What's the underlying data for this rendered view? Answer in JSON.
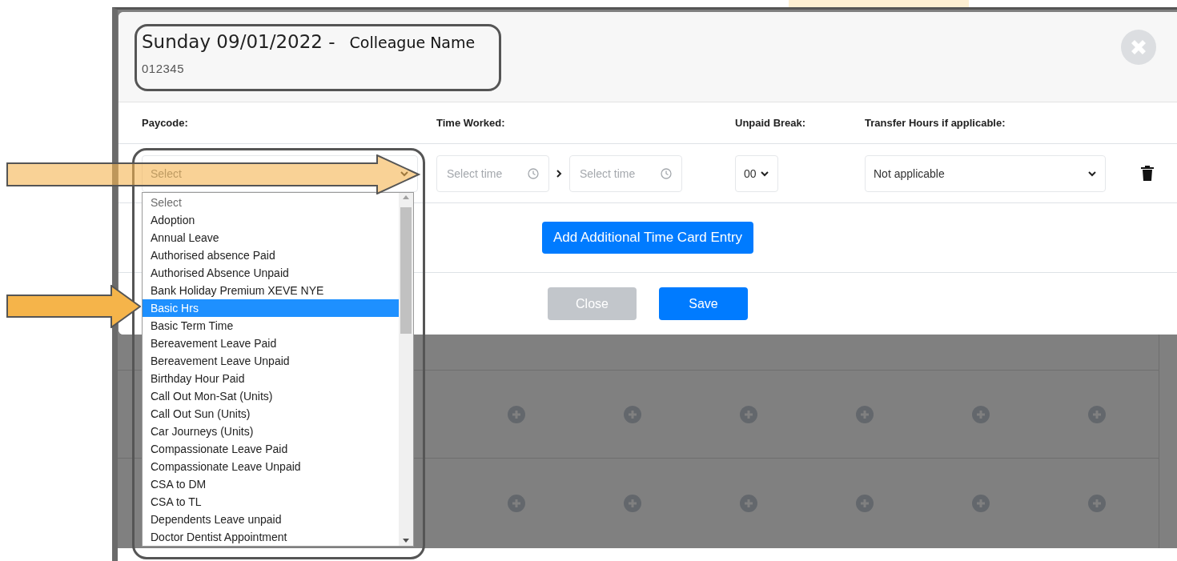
{
  "dialog": {
    "title": "Sunday 09/01/2022 -",
    "colleague_name": "Colleague Name",
    "colleague_id": "012345"
  },
  "columns": [
    "Paycode:",
    "Time Worked:",
    "Unpaid Break:",
    "Transfer Hours if applicable:"
  ],
  "entry": {
    "paycode": "Select",
    "time_from": {
      "placeholder": "Select time"
    },
    "time_to": {
      "placeholder": "Select time"
    },
    "unpaid_break": "00",
    "transfer": "Not applicable"
  },
  "paycode_options": [
    {
      "label": "Select",
      "selected": false,
      "disabled": true
    },
    {
      "label": "Adoption",
      "selected": false,
      "disabled": false
    },
    {
      "label": "Annual Leave",
      "selected": false,
      "disabled": false
    },
    {
      "label": "Authorised absence Paid",
      "selected": false,
      "disabled": false
    },
    {
      "label": "Authorised Absence Unpaid",
      "selected": false,
      "disabled": false
    },
    {
      "label": "Bank Holiday Premium XEVE NYE",
      "selected": false,
      "disabled": false
    },
    {
      "label": "Basic Hrs",
      "selected": true,
      "disabled": false
    },
    {
      "label": "Basic Term Time",
      "selected": false,
      "disabled": false
    },
    {
      "label": "Bereavement Leave Paid",
      "selected": false,
      "disabled": false
    },
    {
      "label": "Bereavement Leave Unpaid",
      "selected": false,
      "disabled": false
    },
    {
      "label": "Birthday Hour Paid",
      "selected": false,
      "disabled": false
    },
    {
      "label": "Call Out Mon-Sat (Units)",
      "selected": false,
      "disabled": false
    },
    {
      "label": "Call Out Sun (Units)",
      "selected": false,
      "disabled": false
    },
    {
      "label": "Car Journeys (Units)",
      "selected": false,
      "disabled": false
    },
    {
      "label": "Compassionate Leave Paid",
      "selected": false,
      "disabled": false
    },
    {
      "label": "Compassionate Leave Unpaid",
      "selected": false,
      "disabled": false
    },
    {
      "label": "CSA to DM",
      "selected": false,
      "disabled": false
    },
    {
      "label": "CSA to TL",
      "selected": false,
      "disabled": false
    },
    {
      "label": "Dependents Leave unpaid",
      "selected": false,
      "disabled": false
    },
    {
      "label": "Doctor Dentist Appointment",
      "selected": false,
      "disabled": false
    }
  ],
  "add_entry_button": "Add Additional Time Card Entry",
  "footer_buttons": [
    {
      "label": "Close",
      "kind": "secondary"
    },
    {
      "label": "Save",
      "kind": "primary"
    }
  ]
}
